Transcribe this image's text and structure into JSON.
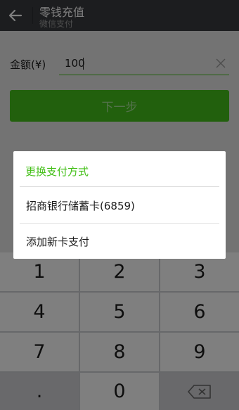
{
  "header": {
    "title": "零钱充值",
    "subtitle": "微信支付",
    "back_icon": "back-arrow-icon"
  },
  "form": {
    "amount_label": "金额(¥)",
    "amount_value": "100",
    "clear_icon": "clear-x-icon",
    "next_button": "下一步"
  },
  "dialog": {
    "title": "更换支付方式",
    "options": [
      "招商银行储蓄卡(6859)",
      "添加新卡支付"
    ]
  },
  "keypad": {
    "keys": [
      "1",
      "2",
      "3",
      "4",
      "5",
      "6",
      "7",
      "8",
      "9",
      ".",
      "0"
    ],
    "delete_icon": "backspace-icon"
  },
  "colors": {
    "accent": "#45c01a",
    "header_bg": "#393a3f"
  }
}
